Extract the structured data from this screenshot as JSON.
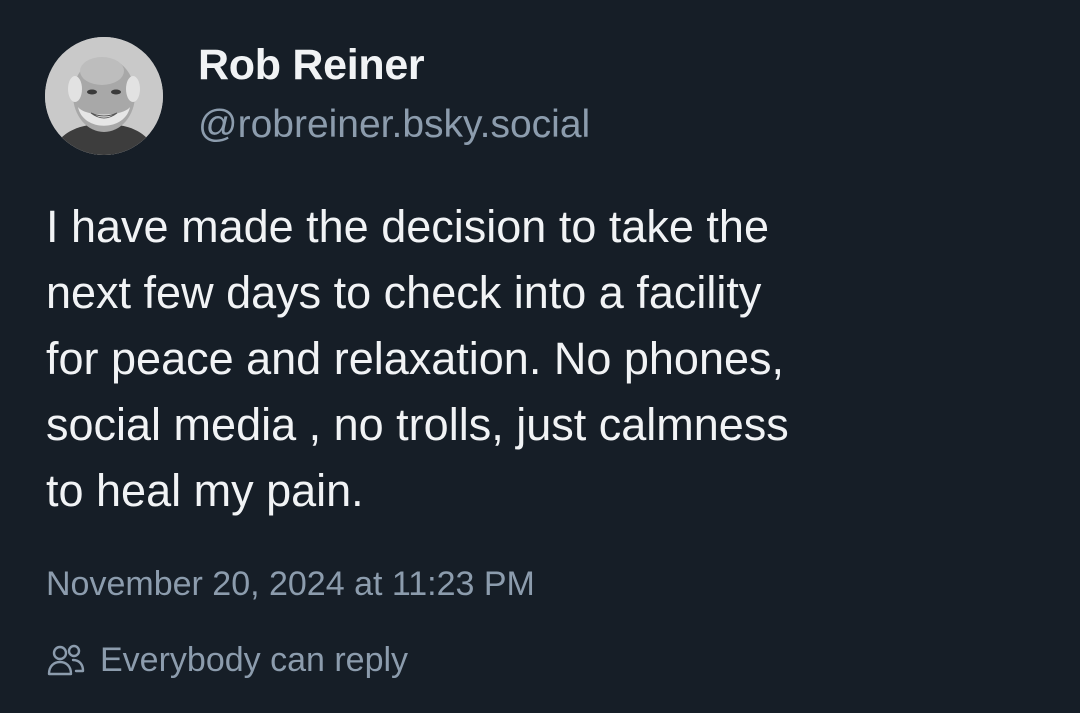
{
  "author": {
    "display_name": "Rob Reiner",
    "handle": "@robreiner.bsky.social",
    "avatar_icon": "user-avatar-photo"
  },
  "post": {
    "text_lines": [
      "I have made the decision to take the",
      "next few days to check into a facility",
      "for peace and relaxation. No phones,",
      "social media , no trolls, just calmness",
      "to heal my pain."
    ],
    "timestamp": "November 20, 2024 at 11:23 PM",
    "reply_setting": "Everybody can reply",
    "reply_icon": "people-icon"
  },
  "colors": {
    "background": "#161e27",
    "primary_text": "#f1f3f5",
    "secondary_text": "#8c9cad"
  }
}
